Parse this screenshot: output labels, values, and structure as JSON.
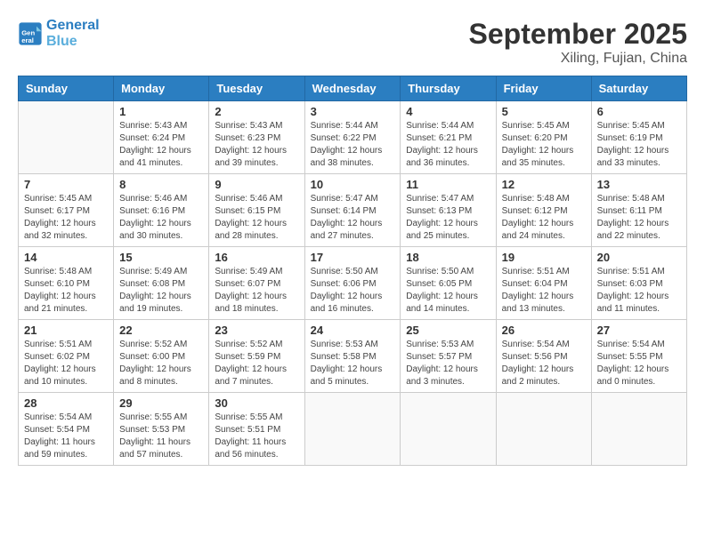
{
  "header": {
    "logo_line1": "General",
    "logo_line2": "Blue",
    "month": "September 2025",
    "location": "Xiling, Fujian, China"
  },
  "days_of_week": [
    "Sunday",
    "Monday",
    "Tuesday",
    "Wednesday",
    "Thursday",
    "Friday",
    "Saturday"
  ],
  "weeks": [
    [
      null,
      {
        "day": "1",
        "sunrise": "5:43 AM",
        "sunset": "6:24 PM",
        "daylight": "12 hours and 41 minutes."
      },
      {
        "day": "2",
        "sunrise": "5:43 AM",
        "sunset": "6:23 PM",
        "daylight": "12 hours and 39 minutes."
      },
      {
        "day": "3",
        "sunrise": "5:44 AM",
        "sunset": "6:22 PM",
        "daylight": "12 hours and 38 minutes."
      },
      {
        "day": "4",
        "sunrise": "5:44 AM",
        "sunset": "6:21 PM",
        "daylight": "12 hours and 36 minutes."
      },
      {
        "day": "5",
        "sunrise": "5:45 AM",
        "sunset": "6:20 PM",
        "daylight": "12 hours and 35 minutes."
      },
      {
        "day": "6",
        "sunrise": "5:45 AM",
        "sunset": "6:19 PM",
        "daylight": "12 hours and 33 minutes."
      }
    ],
    [
      {
        "day": "7",
        "sunrise": "5:45 AM",
        "sunset": "6:17 PM",
        "daylight": "12 hours and 32 minutes."
      },
      {
        "day": "8",
        "sunrise": "5:46 AM",
        "sunset": "6:16 PM",
        "daylight": "12 hours and 30 minutes."
      },
      {
        "day": "9",
        "sunrise": "5:46 AM",
        "sunset": "6:15 PM",
        "daylight": "12 hours and 28 minutes."
      },
      {
        "day": "10",
        "sunrise": "5:47 AM",
        "sunset": "6:14 PM",
        "daylight": "12 hours and 27 minutes."
      },
      {
        "day": "11",
        "sunrise": "5:47 AM",
        "sunset": "6:13 PM",
        "daylight": "12 hours and 25 minutes."
      },
      {
        "day": "12",
        "sunrise": "5:48 AM",
        "sunset": "6:12 PM",
        "daylight": "12 hours and 24 minutes."
      },
      {
        "day": "13",
        "sunrise": "5:48 AM",
        "sunset": "6:11 PM",
        "daylight": "12 hours and 22 minutes."
      }
    ],
    [
      {
        "day": "14",
        "sunrise": "5:48 AM",
        "sunset": "6:10 PM",
        "daylight": "12 hours and 21 minutes."
      },
      {
        "day": "15",
        "sunrise": "5:49 AM",
        "sunset": "6:08 PM",
        "daylight": "12 hours and 19 minutes."
      },
      {
        "day": "16",
        "sunrise": "5:49 AM",
        "sunset": "6:07 PM",
        "daylight": "12 hours and 18 minutes."
      },
      {
        "day": "17",
        "sunrise": "5:50 AM",
        "sunset": "6:06 PM",
        "daylight": "12 hours and 16 minutes."
      },
      {
        "day": "18",
        "sunrise": "5:50 AM",
        "sunset": "6:05 PM",
        "daylight": "12 hours and 14 minutes."
      },
      {
        "day": "19",
        "sunrise": "5:51 AM",
        "sunset": "6:04 PM",
        "daylight": "12 hours and 13 minutes."
      },
      {
        "day": "20",
        "sunrise": "5:51 AM",
        "sunset": "6:03 PM",
        "daylight": "12 hours and 11 minutes."
      }
    ],
    [
      {
        "day": "21",
        "sunrise": "5:51 AM",
        "sunset": "6:02 PM",
        "daylight": "12 hours and 10 minutes."
      },
      {
        "day": "22",
        "sunrise": "5:52 AM",
        "sunset": "6:00 PM",
        "daylight": "12 hours and 8 minutes."
      },
      {
        "day": "23",
        "sunrise": "5:52 AM",
        "sunset": "5:59 PM",
        "daylight": "12 hours and 7 minutes."
      },
      {
        "day": "24",
        "sunrise": "5:53 AM",
        "sunset": "5:58 PM",
        "daylight": "12 hours and 5 minutes."
      },
      {
        "day": "25",
        "sunrise": "5:53 AM",
        "sunset": "5:57 PM",
        "daylight": "12 hours and 3 minutes."
      },
      {
        "day": "26",
        "sunrise": "5:54 AM",
        "sunset": "5:56 PM",
        "daylight": "12 hours and 2 minutes."
      },
      {
        "day": "27",
        "sunrise": "5:54 AM",
        "sunset": "5:55 PM",
        "daylight": "12 hours and 0 minutes."
      }
    ],
    [
      {
        "day": "28",
        "sunrise": "5:54 AM",
        "sunset": "5:54 PM",
        "daylight": "11 hours and 59 minutes."
      },
      {
        "day": "29",
        "sunrise": "5:55 AM",
        "sunset": "5:53 PM",
        "daylight": "11 hours and 57 minutes."
      },
      {
        "day": "30",
        "sunrise": "5:55 AM",
        "sunset": "5:51 PM",
        "daylight": "11 hours and 56 minutes."
      },
      null,
      null,
      null,
      null
    ]
  ]
}
